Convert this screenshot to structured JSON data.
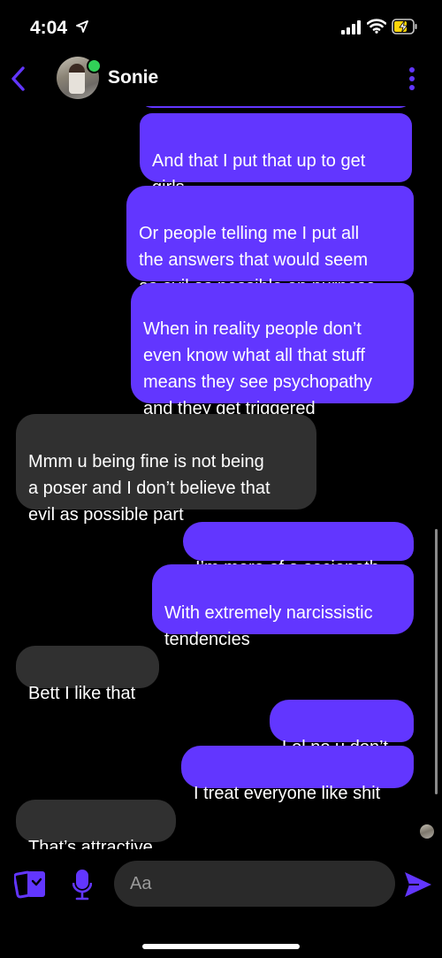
{
  "status_bar": {
    "time": "4:04",
    "icons": [
      "location-arrow-icon",
      "cellular-signal-icon",
      "wifi-icon",
      "battery-charging-icon"
    ]
  },
  "header": {
    "contact_name": "Sonie",
    "online": true,
    "icons": [
      "back-chevron-icon",
      "more-options-icon"
    ]
  },
  "colors": {
    "accent": "#6236ff",
    "sent_bubble": "#6236ff",
    "received_bubble": "#303030",
    "online": "#31d158",
    "background": "#000000"
  },
  "messages": [
    {
      "sender": "me",
      "text": "And that I put that up to get\ngirls"
    },
    {
      "sender": "me",
      "text": "Or people telling me I put all\nthe answers that would seem\nas evil as possible on purpose"
    },
    {
      "sender": "me",
      "text": "When in reality people don’t\neven know what all that stuff\nmeans they see psychopathy\nand they get triggered"
    },
    {
      "sender": "them",
      "text": "Mmm u being fine is not being\na poser and I don’t believe that\nevil as possible part"
    },
    {
      "sender": "me",
      "text": "I’m more of a sociopath"
    },
    {
      "sender": "me",
      "text": "With extremely narcissistic\ntendencies"
    },
    {
      "sender": "them",
      "text": "Bett I like that"
    },
    {
      "sender": "me",
      "text": "Lol no u don’t"
    },
    {
      "sender": "me",
      "text": "I treat everyone like shit"
    },
    {
      "sender": "them",
      "text": "That’s attractive"
    }
  ],
  "composer": {
    "placeholder": "Aa",
    "icons": [
      "cards-icon",
      "microphone-icon",
      "send-icon"
    ]
  }
}
